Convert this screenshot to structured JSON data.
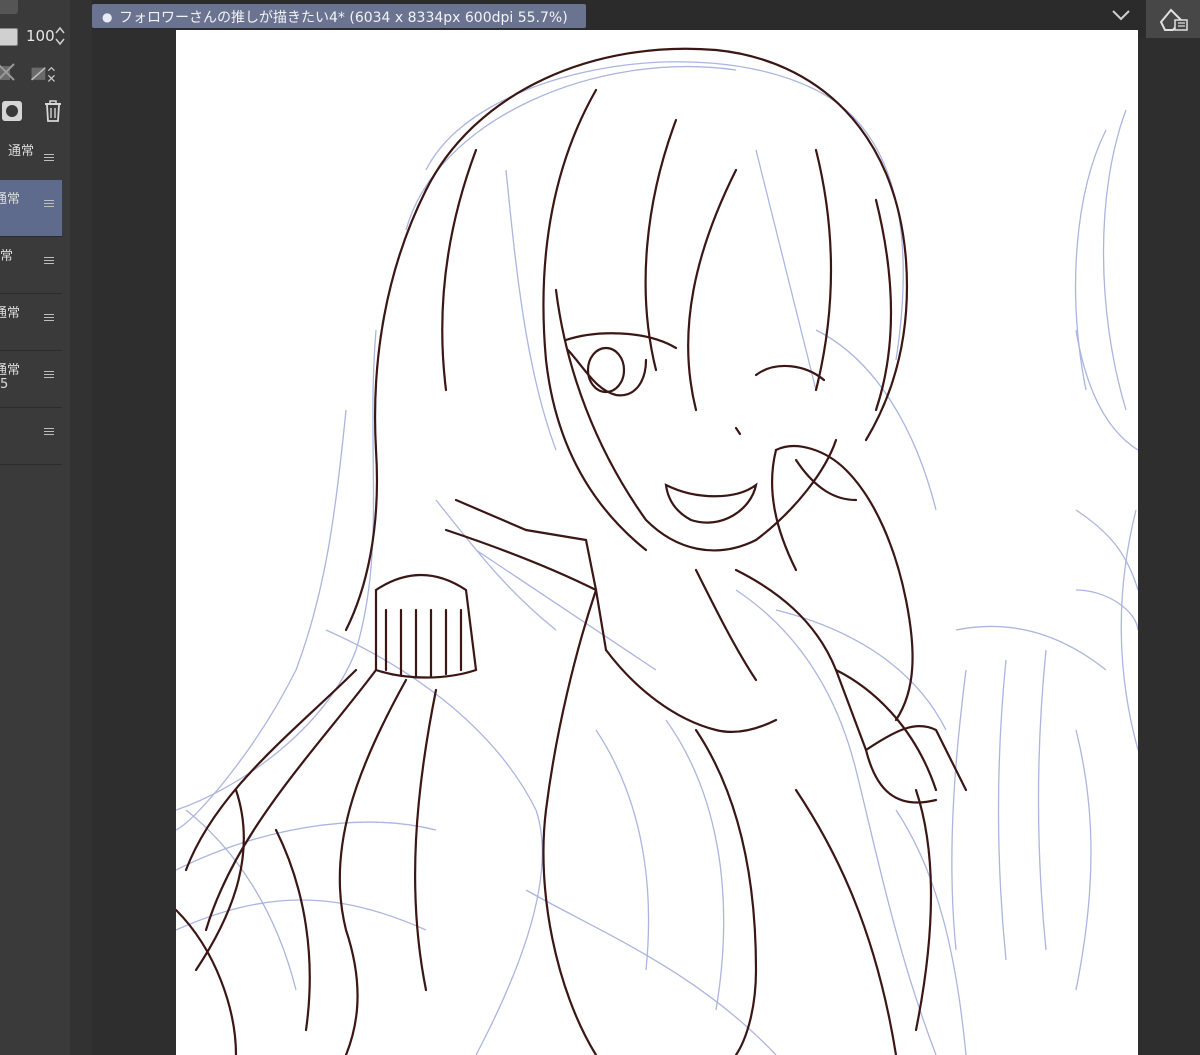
{
  "document_tab": {
    "title": "フォロワーさんの推しが描きたい4* (6034 x 8334px 600dpi 55.7%)",
    "modified_dot": "●"
  },
  "layer_panel": {
    "opacity_value": "100",
    "layers": [
      {
        "mode": "通常",
        "sub": ""
      },
      {
        "mode": "通常",
        "sub": "",
        "active": true
      },
      {
        "mode": "常",
        "sub": ""
      },
      {
        "mode": "通常",
        "sub": ""
      },
      {
        "mode": "通常",
        "sub": "5"
      },
      {
        "mode": "",
        "sub": ""
      }
    ]
  },
  "colors": {
    "accent": "#5e6b8c",
    "sketch_blue": "#9aa6d6",
    "line_brown": "#3a1614"
  },
  "icons": {
    "tab_dropdown": "chevron-down-icon",
    "side_tool": "eraser-layer-icon",
    "delete": "trash-icon",
    "mask": "layer-mask-icon"
  }
}
